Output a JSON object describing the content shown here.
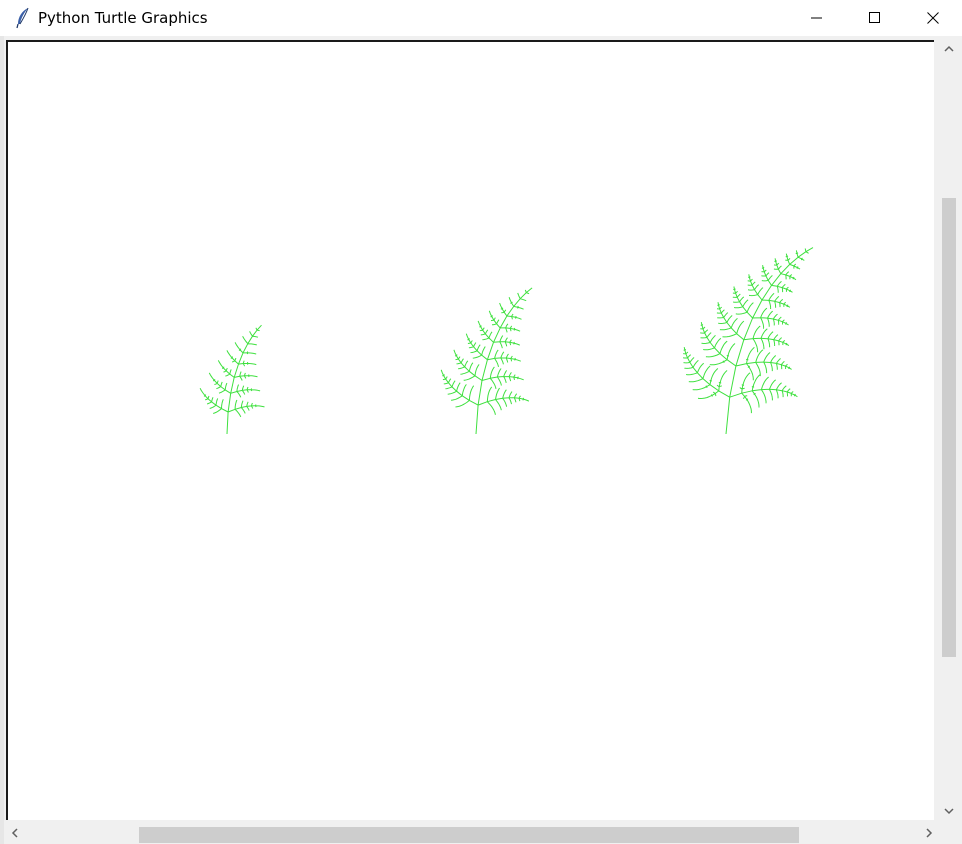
{
  "window": {
    "title": "Python Turtle Graphics",
    "icons": {
      "app": "feather-icon",
      "minimize": "minimize-icon",
      "maximize": "maximize-icon",
      "close": "close-icon"
    }
  },
  "canvas": {
    "background": "#ffffff",
    "ink_color": "#3ee03e",
    "drawing": "three fractal ferns of increasing size",
    "ferns": [
      {
        "name": "small-fern",
        "depth": "small"
      },
      {
        "name": "medium-fern",
        "depth": "medium"
      },
      {
        "name": "large-fern",
        "depth": "large"
      }
    ]
  },
  "scrollbars": {
    "vertical": {
      "icons": [
        "chevron-up-icon",
        "chevron-down-icon"
      ]
    },
    "horizontal": {
      "icons": [
        "chevron-left-icon",
        "chevron-right-icon"
      ]
    }
  }
}
